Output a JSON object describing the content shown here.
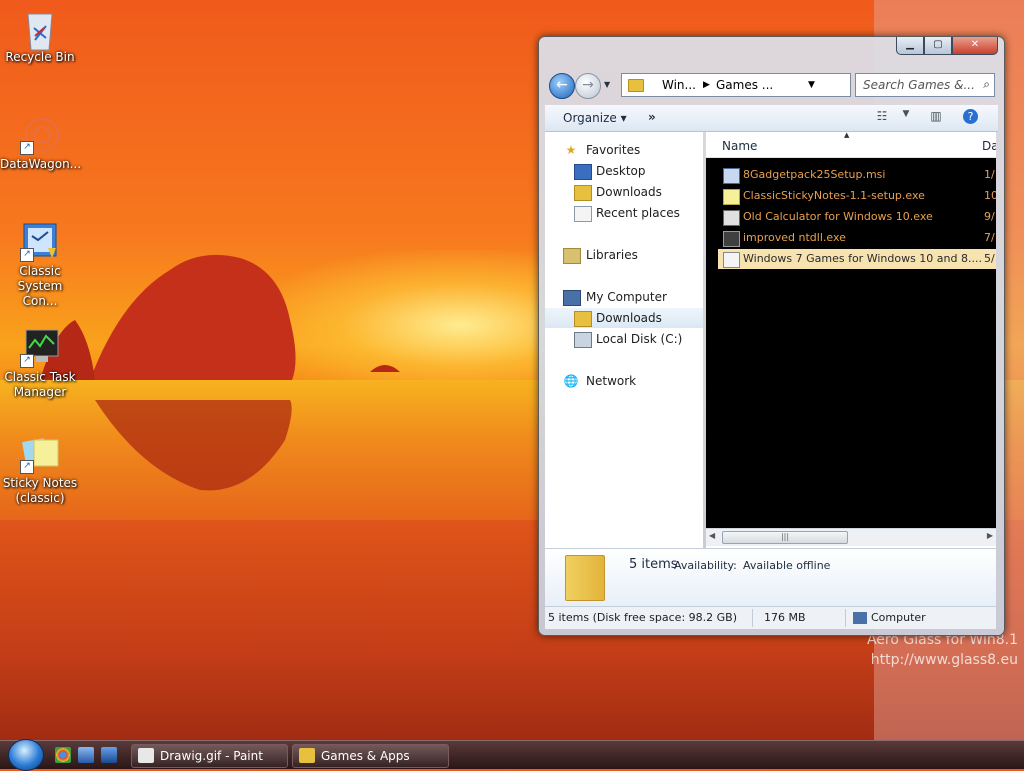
{
  "desktop": {
    "icons": [
      {
        "label": "Recycle Bin",
        "icon": "recycle-bin-icon"
      },
      {
        "label": "DataWagon...",
        "icon": "datawagon-icon"
      },
      {
        "label": "Classic System Con...",
        "icon": "control-panel-icon"
      },
      {
        "label": "Classic Task Manager",
        "icon": "task-manager-icon"
      },
      {
        "label": "Sticky Notes (classic)",
        "icon": "sticky-notes-icon"
      }
    ],
    "watermark_line1": "Aero Glass for Win8.1",
    "watermark_line2": "http://www.glass8.eu"
  },
  "window": {
    "breadcrumb": [
      "Win...",
      "Games ..."
    ],
    "search_placeholder": "Search Games &...",
    "toolbar": {
      "organize": "Organize",
      "more": "»"
    },
    "nav": {
      "favorites": "Favorites",
      "desktop": "Desktop",
      "downloads": "Downloads",
      "recent": "Recent places",
      "libraries": "Libraries",
      "my_computer": "My Computer",
      "downloads2": "Downloads",
      "local_disk": "Local Disk (C:)",
      "network": "Network"
    },
    "columns": {
      "name": "Name",
      "date": "Da"
    },
    "files": [
      {
        "name": "8Gadgetpack25Setup.msi",
        "date": "1/"
      },
      {
        "name": "ClassicStickyNotes-1.1-setup.exe",
        "date": "10"
      },
      {
        "name": "Old Calculator for Windows 10.exe",
        "date": "9/"
      },
      {
        "name": "improved            ntdll.exe",
        "date": "7/"
      },
      {
        "name": "Windows 7 Games for Windows 10 and 8....",
        "date": "5/"
      }
    ],
    "details": {
      "count": "5 items",
      "availability_label": "Availability:",
      "availability_value": "Available offline"
    },
    "status": {
      "items": "5 items (Disk free space: 98.2 GB)",
      "size": "176 MB",
      "location": "Computer"
    }
  },
  "taskbar": {
    "buttons": [
      {
        "label": "Drawig.gif - Paint"
      },
      {
        "label": "Games & Apps"
      }
    ]
  }
}
